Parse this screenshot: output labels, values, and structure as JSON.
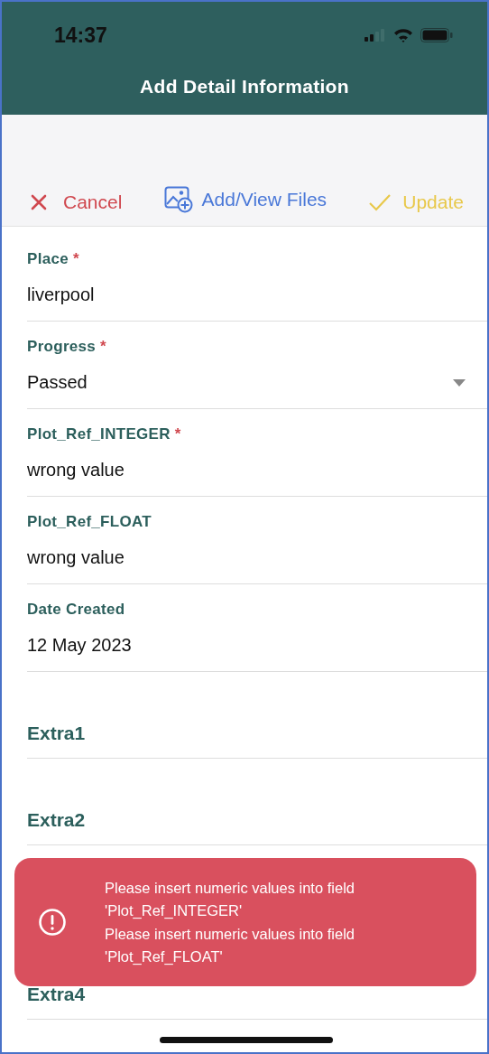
{
  "status_bar": {
    "time": "14:37"
  },
  "header": {
    "title": "Add Detail Information"
  },
  "actions": [
    {
      "kind": "cancel",
      "label": "Cancel"
    },
    {
      "kind": "files",
      "label": "Add/View Files"
    },
    {
      "kind": "update",
      "label": "Update"
    }
  ],
  "fields": [
    {
      "label": "Place",
      "required_mark": "*",
      "value": "liverpool",
      "kind": "text"
    },
    {
      "label": "Progress",
      "required_mark": "*",
      "value": "Passed",
      "kind": "dropdown"
    },
    {
      "label": "Plot_Ref_INTEGER",
      "required_mark": "*",
      "value": "wrong value",
      "kind": "text"
    },
    {
      "label": "Plot_Ref_FLOAT",
      "value": "wrong value",
      "kind": "text"
    },
    {
      "label": "Date Created",
      "value": "12 May 2023",
      "kind": "text"
    }
  ],
  "extras": [
    {
      "label": "Extra1"
    },
    {
      "label": "Extra2"
    },
    {
      "label": "Extra4"
    }
  ],
  "toast": {
    "messages": [
      "Please insert numeric values into field 'Plot_Ref_INTEGER'",
      "Please insert numeric values into field 'Plot_Ref_FLOAT'"
    ]
  }
}
